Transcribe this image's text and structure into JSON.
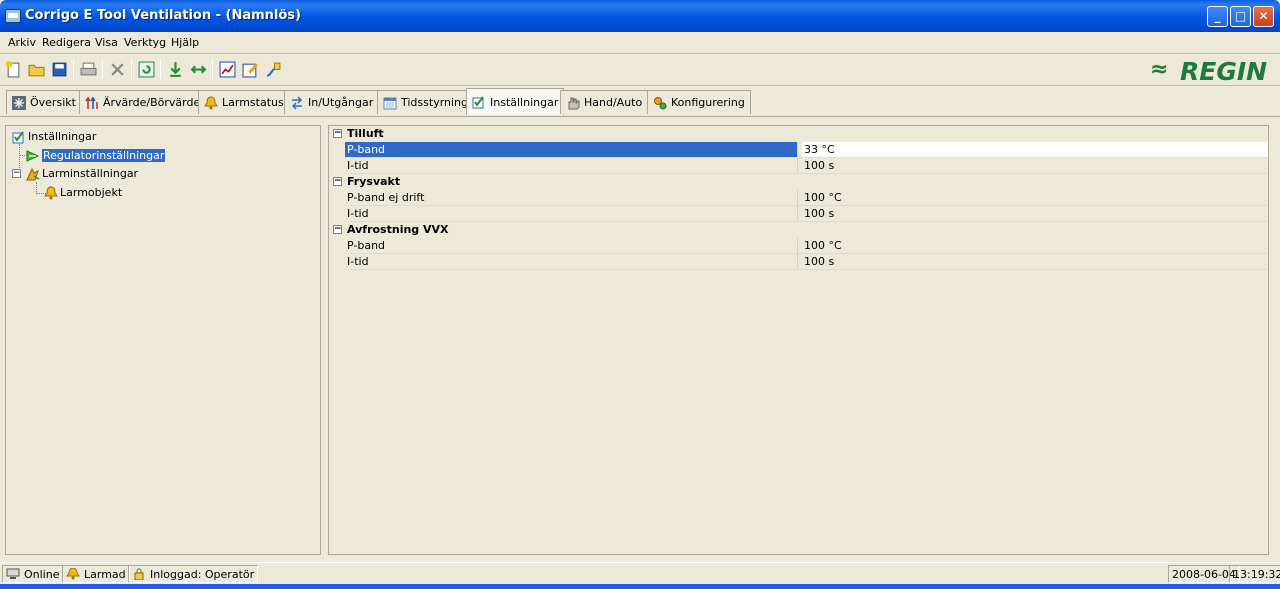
{
  "window": {
    "title": "Corrigo E Tool Ventilation - (Namnlös)",
    "minimize": "_",
    "maximize": "□",
    "close": "✕"
  },
  "menu": [
    "Arkiv",
    "Redigera",
    "Visa",
    "Verktyg",
    "Hjälp"
  ],
  "logo": {
    "mark": "≈",
    "text": "REGIN",
    "color": "#1E7A3A"
  },
  "tabs": [
    {
      "label": "Översikt",
      "icon": "snowflake-icon"
    },
    {
      "label": "Ärvärde/Börvärde",
      "icon": "arrows-up-icon"
    },
    {
      "label": "Larmstatus",
      "icon": "bell-icon"
    },
    {
      "label": "In/Utgångar",
      "icon": "io-arrows-icon"
    },
    {
      "label": "Tidsstyrning",
      "icon": "calendar-icon"
    },
    {
      "label": "Inställningar",
      "icon": "checkbox-icon",
      "active": true
    },
    {
      "label": "Hand/Auto",
      "icon": "hand-icon"
    },
    {
      "label": "Konfigurering",
      "icon": "config-icon"
    }
  ],
  "tree": {
    "root": "Inställningar",
    "items": [
      {
        "label": "Regulatorinställningar",
        "selected": true
      },
      {
        "label": "Larminställningar",
        "children": [
          "Larmobjekt"
        ]
      }
    ]
  },
  "grid": {
    "groups": [
      {
        "title": "Tilluft",
        "rows": [
          {
            "name": "P-band",
            "value": "33 °C",
            "selected": true
          },
          {
            "name": "I-tid",
            "value": "100 s"
          }
        ]
      },
      {
        "title": "Frysvakt",
        "rows": [
          {
            "name": "P-band ej drift",
            "value": "100 °C"
          },
          {
            "name": "I-tid",
            "value": "100 s"
          }
        ]
      },
      {
        "title": "Avfrostning VVX",
        "rows": [
          {
            "name": "P-band",
            "value": "100 °C"
          },
          {
            "name": "I-tid",
            "value": "100 s"
          }
        ]
      }
    ]
  },
  "status": {
    "online": "Online",
    "alarm": "Larmad",
    "login": "Inloggad: Operatör",
    "date": "2008-06-04",
    "time": "13:19:32"
  }
}
